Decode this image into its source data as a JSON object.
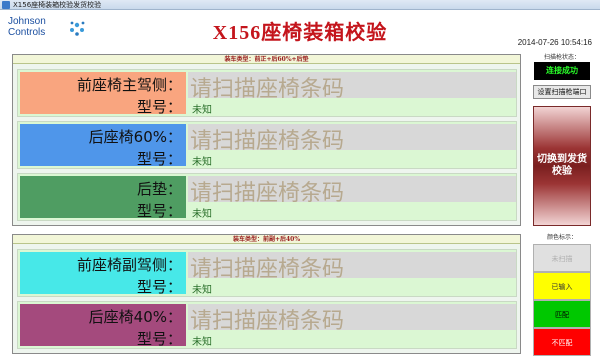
{
  "window": {
    "title": "X156座椅装箱校验发货校验"
  },
  "header": {
    "logo_line1": "Johnson",
    "logo_line2": "Controls",
    "page_title": "X156座椅装箱校验",
    "datetime": "2014-07-26 10:54:16"
  },
  "groups": [
    {
      "caption": "装车类型：前正+后60%+后垫",
      "rows": [
        {
          "name": "前座椅主驾侧：",
          "model_label": "型号：",
          "scan_placeholder": "请扫描座椅条码",
          "model_value": "未知",
          "color": "#f9a57f"
        },
        {
          "name": "后座椅60%：",
          "model_label": "型号：",
          "scan_placeholder": "请扫描座椅条码",
          "model_value": "未知",
          "color": "#4f96ea"
        },
        {
          "name": "后垫：",
          "model_label": "型号：",
          "scan_placeholder": "请扫描座椅条码",
          "model_value": "未知",
          "color": "#4f9d62"
        }
      ]
    },
    {
      "caption": "装车类型：前副+后40%",
      "rows": [
        {
          "name": "前座椅副驾侧：",
          "model_label": "型号：",
          "scan_placeholder": "请扫描座椅条码",
          "model_value": "未知",
          "color": "#47e8e8"
        },
        {
          "name": "后座椅40%：",
          "model_label": "型号：",
          "scan_placeholder": "请扫描座椅条码",
          "model_value": "未知",
          "color": "#a44a7d"
        }
      ]
    }
  ],
  "right_panel": {
    "scanner_caption": "扫描枪状态：",
    "scanner_status": "连接成功",
    "set_port_button": "设置扫描枪端口",
    "switch_button": "切换到发货校验",
    "legend_caption": "颜色标示：",
    "legend": [
      {
        "label": "未扫描",
        "bg": "#e0e0e0",
        "fg": "#b0b0b0"
      },
      {
        "label": "已输入",
        "bg": "#ffff00",
        "fg": "#333333"
      },
      {
        "label": "匹配",
        "bg": "#00c800",
        "fg": "#000000"
      },
      {
        "label": "不匹配",
        "bg": "#ff0000",
        "fg": "#ffffff"
      }
    ]
  }
}
